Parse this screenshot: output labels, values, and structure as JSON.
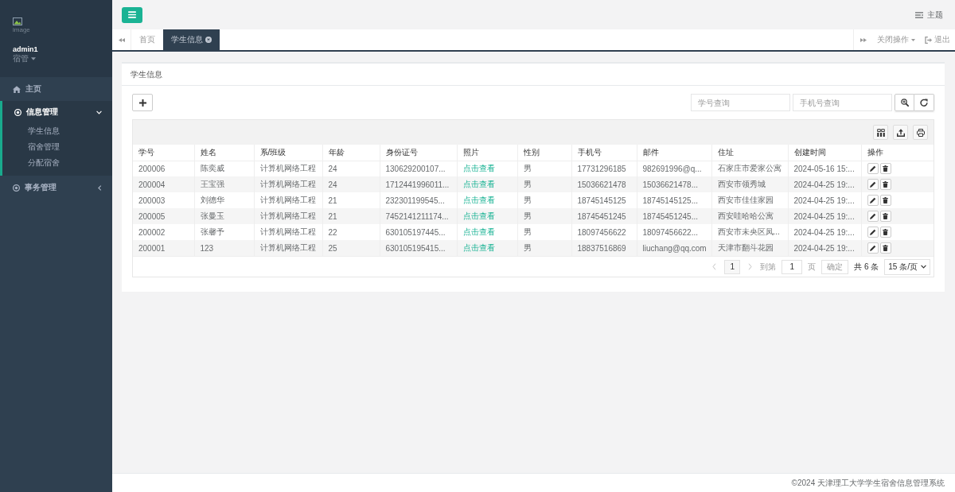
{
  "sidebar": {
    "logo_alt": "image",
    "user": {
      "name": "admin1",
      "role": "宿管"
    },
    "menu": [
      {
        "kind": "link",
        "label": "主页",
        "selected": false
      },
      {
        "kind": "group",
        "label": "信息管理",
        "selected": true,
        "expanded": true,
        "children": [
          {
            "label": "学生信息"
          },
          {
            "label": "宿舍管理"
          },
          {
            "label": "分配宿舍"
          }
        ]
      },
      {
        "kind": "group",
        "label": "事务管理",
        "selected": false,
        "expanded": false
      }
    ]
  },
  "topbar": {
    "theme": "主题"
  },
  "tab_bar": {
    "tabs": [
      {
        "label": "首页",
        "selected": false,
        "closable": false
      },
      {
        "label": "学生信息",
        "selected": true,
        "closable": true
      }
    ],
    "close_menu": "关闭操作",
    "logout": "退出"
  },
  "panel": {
    "title": "学生信息",
    "search_fields": [
      {
        "placeholder": "学号查询"
      },
      {
        "placeholder": "手机号查询"
      }
    ],
    "table": {
      "columns": [
        {
          "label": "学号",
          "kind": "text"
        },
        {
          "label": "姓名",
          "kind": "text"
        },
        {
          "label": "系/班级",
          "kind": "text"
        },
        {
          "label": "年龄",
          "kind": "text"
        },
        {
          "label": "身份证号",
          "kind": "text"
        },
        {
          "label": "照片",
          "kind": "link"
        },
        {
          "label": "性别",
          "kind": "text"
        },
        {
          "label": "手机号",
          "kind": "text"
        },
        {
          "label": "邮件",
          "kind": "text"
        },
        {
          "label": "住址",
          "kind": "text"
        },
        {
          "label": "创建时间",
          "kind": "text"
        },
        {
          "label": "操作",
          "kind": "actions"
        }
      ],
      "rows": [
        {
          "cells": [
            "200006",
            "陈奕威",
            "计算机网络工程",
            "24",
            "130629200107...",
            "点击查看",
            "男",
            "17731296185",
            "982691996@q...",
            "石家庄市爱家公寓",
            "2024-05-16 15:..."
          ]
        },
        {
          "cells": [
            "200004",
            "王宝强",
            "计算机网络工程",
            "24",
            "1712441996011...",
            "点击查看",
            "男",
            "15036621478",
            "15036621478...",
            "西安市领秀城",
            "2024-04-25 19:..."
          ]
        },
        {
          "cells": [
            "200003",
            "刘德华",
            "计算机网络工程",
            "21",
            "232301199545...",
            "点击查看",
            "男",
            "18745145125",
            "18745145125...",
            "西安市佳佳家园",
            "2024-04-25 19:..."
          ]
        },
        {
          "cells": [
            "200005",
            "张曼玉",
            "计算机网络工程",
            "21",
            "7452141211174...",
            "点击查看",
            "男",
            "18745451245",
            "18745451245...",
            "西安哇哈哈公寓",
            "2024-04-25 19:..."
          ]
        },
        {
          "cells": [
            "200002",
            "张馨予",
            "计算机网络工程",
            "22",
            "630105197445...",
            "点击查看",
            "男",
            "18097456622",
            "18097456622...",
            "西安市未央区凤...",
            "2024-04-25 19:..."
          ]
        },
        {
          "cells": [
            "200001",
            "123",
            "计算机网络工程",
            "25",
            "630105195415...",
            "点击查看",
            "男",
            "18837516869",
            "liuchang@qq.com",
            "天津市翻斗花园",
            "2024-04-25 19:..."
          ]
        }
      ]
    },
    "pagination": {
      "prev_disabled": true,
      "pages": [
        {
          "label": "1",
          "selected": true
        }
      ],
      "next_disabled": true,
      "goto_label": "到第",
      "goto_value": "1",
      "page_label": "页",
      "confirm": "确定",
      "total": "共 6 条",
      "page_size": "15 条/页"
    }
  },
  "footer": "©2024 天津理工大学学生宿舍信息管理系统"
}
